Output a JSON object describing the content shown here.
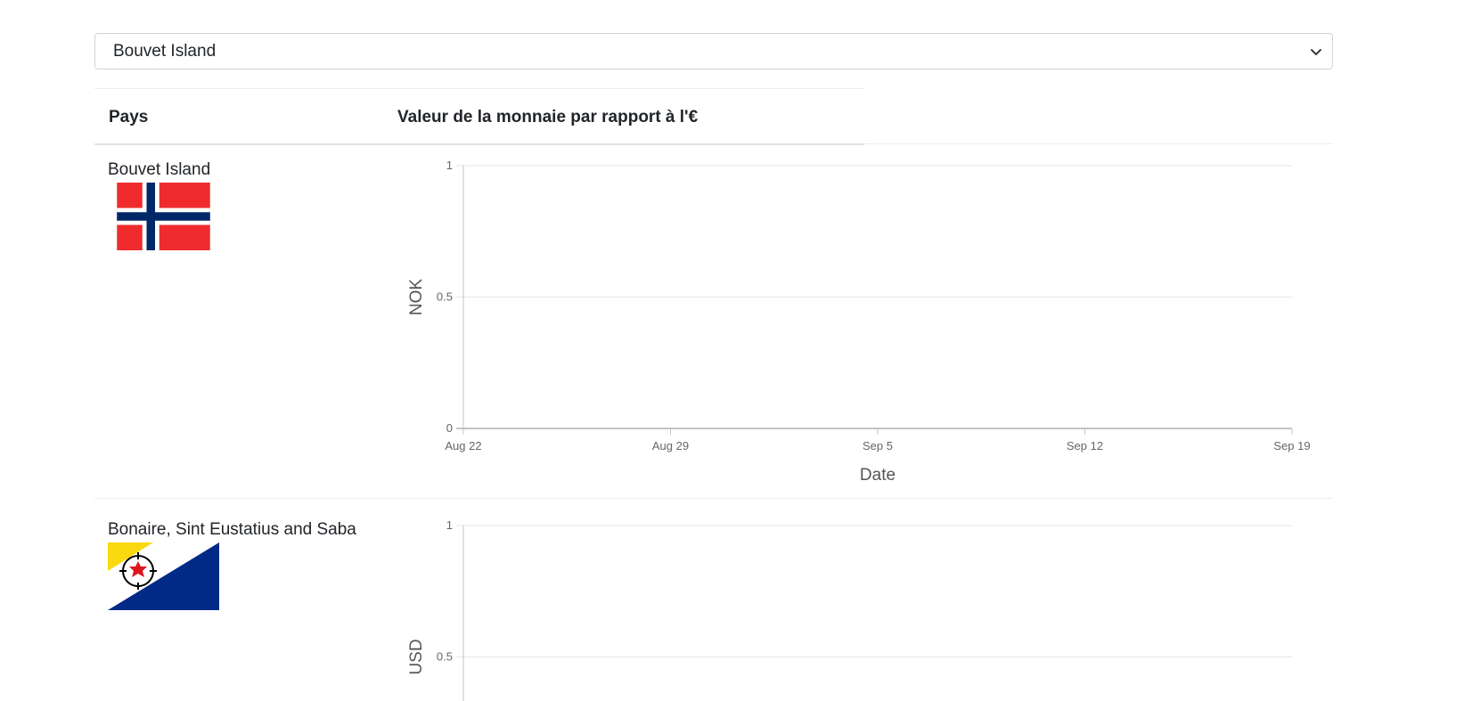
{
  "select": {
    "value": "Bouvet Island"
  },
  "table": {
    "headers": {
      "country": "Pays",
      "value": "Valeur de la monnaie par rapport à l'€"
    }
  },
  "rows": [
    {
      "country": "Bouvet Island",
      "flag": "norway-flag"
    },
    {
      "country": "Bonaire, Sint Eustatius and Saba",
      "flag": "bonaire-flag"
    }
  ],
  "chart_data": [
    {
      "type": "line",
      "title": "",
      "xlabel": "Date",
      "ylabel": "NOK",
      "ylim": [
        0,
        1
      ],
      "y_ticks": [
        "0",
        "0.5",
        "1"
      ],
      "x_ticks": [
        "Aug 22",
        "Aug 29",
        "Sep 5",
        "Sep 12",
        "Sep 19"
      ],
      "series": [],
      "grid": true
    },
    {
      "type": "line",
      "title": "",
      "xlabel": "",
      "ylabel": "USD",
      "ylim": [
        0,
        1
      ],
      "y_ticks": [
        "0.5",
        "1"
      ],
      "x_ticks": [],
      "series": [],
      "grid": true
    }
  ],
  "colors": {
    "border": "#ced4da",
    "grid": "#e5e5e5",
    "norway_red": "#ef2b2d",
    "norway_blue": "#002868",
    "bonaire_yellow": "#f9d90f",
    "bonaire_blue": "#012a87"
  }
}
